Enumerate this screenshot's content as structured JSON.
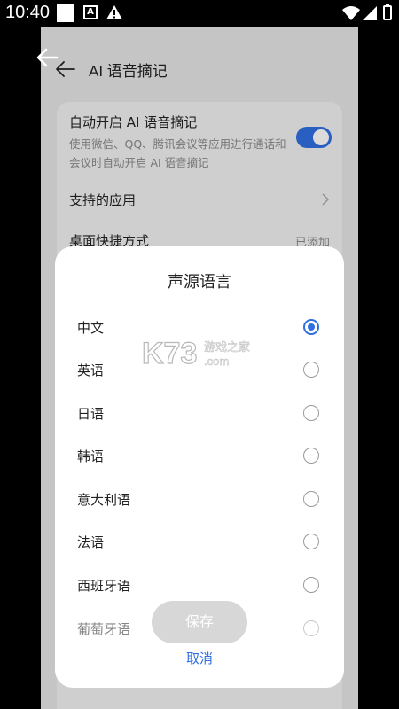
{
  "status_bar": {
    "time": "10:40",
    "notif_letter": "A"
  },
  "header": {
    "title": "AI 语音摘记"
  },
  "settings": {
    "auto": {
      "title": "自动开启 AI 语音摘记",
      "desc": "使用微信、QQ、腾讯会议等应用进行通话和会议时自动开启 AI 语音摘记",
      "enabled": true
    },
    "supported_apps": {
      "title": "支持的应用"
    },
    "shortcut": {
      "title": "桌面快捷方式",
      "value": "已添加"
    }
  },
  "dialog": {
    "title": "声源语言",
    "options": [
      {
        "label": "中文",
        "selected": true
      },
      {
        "label": "英语",
        "selected": false
      },
      {
        "label": "日语",
        "selected": false
      },
      {
        "label": "韩语",
        "selected": false
      },
      {
        "label": "意大利语",
        "selected": false
      },
      {
        "label": "法语",
        "selected": false
      },
      {
        "label": "西班牙语",
        "selected": false
      },
      {
        "label": "葡萄牙语",
        "selected": false
      }
    ],
    "save": "保存",
    "cancel": "取消"
  },
  "watermark": {
    "brand": "K73",
    "cn": "游戏之家",
    "url": ".com"
  },
  "colors": {
    "accent": "#2f6fe0",
    "status_bar": "#000000"
  }
}
